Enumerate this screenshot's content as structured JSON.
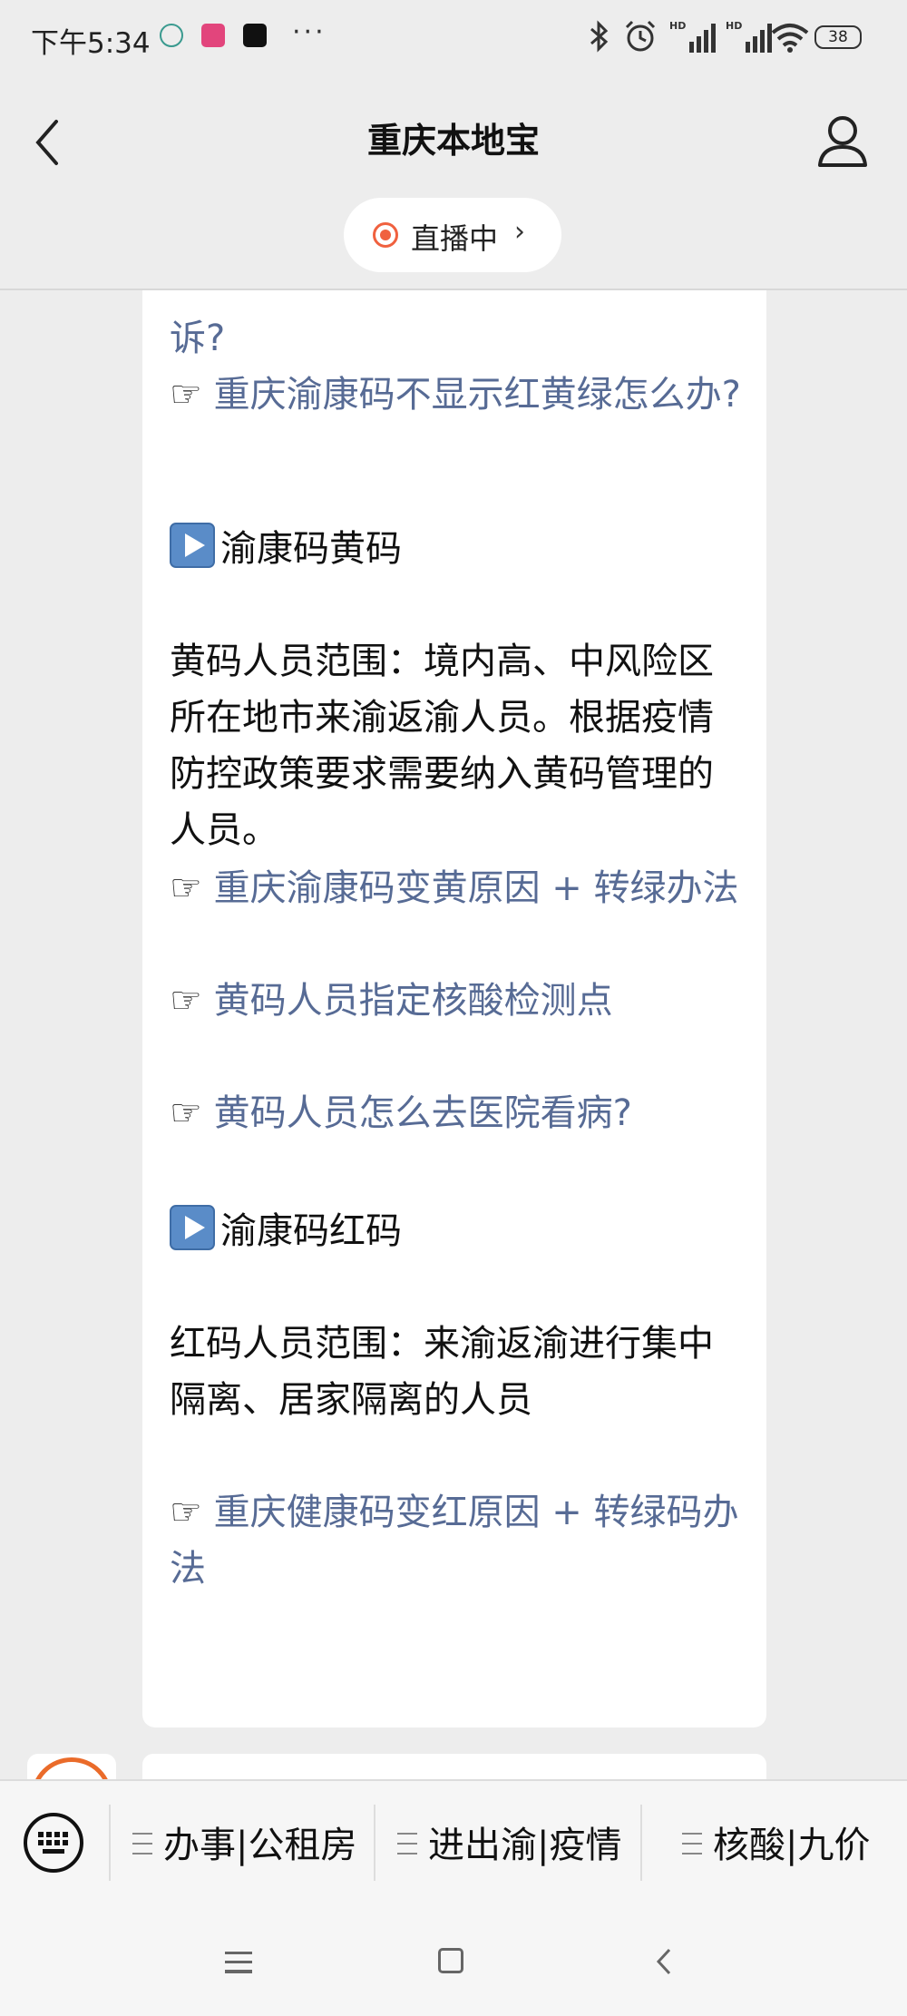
{
  "status_bar": {
    "time": "下午5:34",
    "more": "···",
    "battery": "38"
  },
  "header": {
    "title": "重庆本地宝",
    "live_label": "直播中",
    "live_chevron": "›"
  },
  "article": {
    "partial_top": "诉?",
    "hand": "☞",
    "link_1": "重庆渝康码不显示红黄绿怎么办?",
    "section_yellow": "渝康码黄码",
    "yellow_desc": "黄码人员范围：境内高、中风险区所在地市来渝返渝人员。根据疫情防控政策要求需要纳入黄码管理的人员。",
    "link_2": "重庆渝康码变黄原因 + 转绿办法",
    "link_3": "黄码人员指定核酸检测点",
    "link_4": "黄码人员怎么去医院看病?",
    "section_red": "渝康码红码",
    "red_desc": "红码人员范围：来渝返渝进行集中隔离、居家隔离的人员",
    "link_5": "重庆健康码变红原因 + 转绿码办法"
  },
  "menu": {
    "items": [
      {
        "label": "办事|公租房"
      },
      {
        "label": "进出渝|疫情"
      },
      {
        "label": "核酸|九价"
      }
    ]
  },
  "colors": {
    "link": "#576b95",
    "live_dot": "#f0613f",
    "background": "#ededed"
  }
}
